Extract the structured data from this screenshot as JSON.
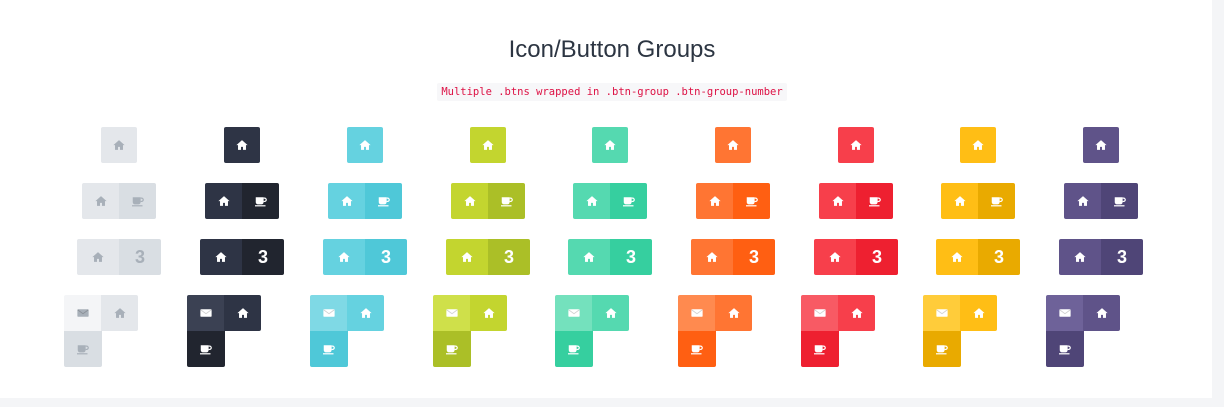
{
  "header": {
    "title": "Icon/Button Groups",
    "code_snippet": "Multiple .btns wrapped in .btn-group .btn-group-number"
  },
  "icons": {
    "home": "home-icon",
    "coffee": "coffee-icon",
    "envelope": "envelope-icon"
  },
  "rows": [
    {
      "type": "single",
      "icons": [
        "home-icon"
      ]
    },
    {
      "type": "pair",
      "icons": [
        "home-icon",
        "coffee-icon"
      ]
    },
    {
      "type": "number",
      "icon": "home-icon",
      "number": "3"
    },
    {
      "type": "grid",
      "icons": [
        "envelope-icon",
        "home-icon",
        "coffee-icon"
      ]
    }
  ],
  "color_groups": [
    {
      "name": "light",
      "colors": {
        "c1": "#f4f5f7",
        "c2": "#e4e7eb",
        "c3": "#d9dee3"
      },
      "icon_color": "#a8b0b9"
    },
    {
      "name": "dark",
      "colors": {
        "c1": "#3b4153",
        "c2": "#2e3445",
        "c3": "#21252f"
      },
      "icon_color": "#ffffff"
    },
    {
      "name": "info",
      "colors": {
        "c1": "#7fd9e5",
        "c2": "#65d2e0",
        "c3": "#4fc8d8"
      },
      "icon_color": "#ffffff"
    },
    {
      "name": "lime",
      "colors": {
        "c1": "#cfe04a",
        "c2": "#c3d52f",
        "c3": "#abbf27"
      },
      "icon_color": "#ffffff"
    },
    {
      "name": "teal",
      "colors": {
        "c1": "#74e1bd",
        "c2": "#55d9b0",
        "c3": "#36cf9f"
      },
      "icon_color": "#ffffff"
    },
    {
      "name": "orange",
      "colors": {
        "c1": "#ff8a4f",
        "c2": "#ff7533",
        "c3": "#ff5f12"
      },
      "icon_color": "#ffffff"
    },
    {
      "name": "red",
      "colors": {
        "c1": "#f85a64",
        "c2": "#f73f4b",
        "c3": "#ee2030"
      },
      "icon_color": "#ffffff"
    },
    {
      "name": "yellow",
      "colors": {
        "c1": "#ffcc3a",
        "c2": "#ffbe15",
        "c3": "#e9aa00"
      },
      "icon_color": "#ffffff"
    },
    {
      "name": "purple",
      "colors": {
        "c1": "#6e6299",
        "c2": "#5f5389",
        "c3": "#4f4577"
      },
      "icon_color": "#ffffff"
    }
  ]
}
